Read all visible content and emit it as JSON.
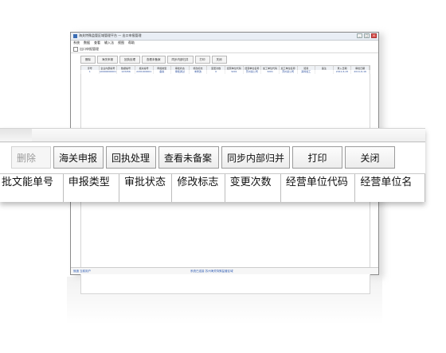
{
  "window": {
    "title": "海关特殊监管区域管理平台 — 出口申报管理",
    "menu": [
      "系统",
      "数据",
      "查看",
      "输入法",
      "视图",
      "帮助"
    ],
    "address_label": "出口申报管理",
    "win_buttons": [
      "_",
      "□",
      "×"
    ]
  },
  "mini_toolbar": [
    "删除",
    "海关申报",
    "回执处理",
    "查看未备案",
    "同步内部归并",
    "打印",
    "关闭"
  ],
  "mini_table": {
    "headers": [
      "序号",
      "企业内部编号",
      "数据编号",
      "报关编号",
      "申报类型",
      "审批状态",
      "修改标志",
      "变更次数",
      "经营单位代码",
      "经营单位名称",
      "加工单位代码",
      "加工单位名称",
      "贸易",
      "备注",
      "录入日期",
      "审批日期"
    ],
    "row": [
      "1",
      "A0000000001",
      "123456",
      "2201000001",
      "备案",
      "审批通过",
      "未修改",
      "0",
      "3201",
      "苏州某公司",
      "3201",
      "苏州某公司",
      "来料加工",
      "",
      "2011-6-15",
      "2011-6-16"
    ]
  },
  "status": {
    "left": "就绪  当前用户",
    "center": "系统已连接  苏州海关特殊监管区域"
  },
  "zoom": {
    "toolbar": [
      {
        "label": "删除",
        "disabled": true
      },
      {
        "label": "海关申报",
        "disabled": false
      },
      {
        "label": "回执处理",
        "disabled": false
      },
      {
        "label": "查看未备案",
        "disabled": false
      },
      {
        "label": "同步内部归并",
        "disabled": false
      },
      {
        "label": "打印",
        "disabled": false
      },
      {
        "label": "关闭",
        "disabled": false
      }
    ],
    "columns": [
      "批文能单号",
      "申报类型",
      "审批状态",
      "修改标志",
      "变更次数",
      "经营单位代码",
      "经营单位名"
    ]
  }
}
